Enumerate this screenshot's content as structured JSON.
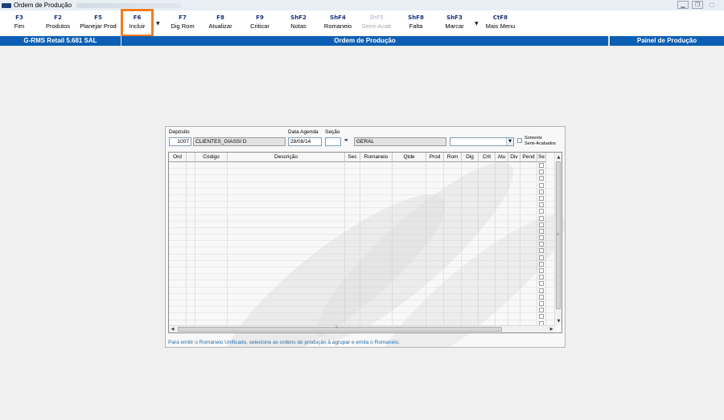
{
  "window": {
    "title": "Ordem de Produção",
    "controls": [
      "minimize-icon",
      "restore-icon",
      "close-icon"
    ]
  },
  "toolbar": {
    "buttons": [
      {
        "key": "F3",
        "label": "Fim",
        "enabled": true
      },
      {
        "key": "F2",
        "label": "Produtos",
        "enabled": true
      },
      {
        "key": "F5",
        "label": "Planejar Prod",
        "enabled": true
      },
      {
        "key": "F6",
        "label": "Incluir",
        "enabled": true,
        "highlighted": true
      },
      {
        "key": "F7",
        "label": "Dig Rom",
        "enabled": true
      },
      {
        "key": "F8",
        "label": "Atualizar",
        "enabled": true
      },
      {
        "key": "F9",
        "label": "Criticar",
        "enabled": true
      },
      {
        "key": "ShF2",
        "label": "Notas",
        "enabled": true
      },
      {
        "key": "ShF4",
        "label": "Romaneio",
        "enabled": true
      },
      {
        "key": "ShF5",
        "label": "Semi-Acab",
        "enabled": false
      },
      {
        "key": "ShF8",
        "label": "Falta",
        "enabled": true
      },
      {
        "key": "ShF3",
        "label": "Marcar",
        "enabled": true
      },
      {
        "key": "CtF8",
        "label": "Mais Menu",
        "enabled": true
      }
    ]
  },
  "header": {
    "left": "G-RMS Retail 5.681 SAL",
    "center": "Ordem de Produção",
    "right": "Painel de Produção"
  },
  "filters": {
    "deposito_label": "Depósito",
    "deposito_code": "1007",
    "deposito_name": "CLIENTES_GIASSI D",
    "data_agenda_label": "Data Agenda",
    "data_agenda_value": "28/08/14",
    "secao_label": "Seção",
    "secao_value": "",
    "secao_name": "GERAL",
    "combo_value": "",
    "somente_label_1": "Somente",
    "somente_label_2": "Semi-Acabados",
    "somente_checked": false
  },
  "grid": {
    "columns": [
      "Ord",
      "",
      "Código",
      "Descrição",
      "Sec",
      "Romaneio",
      "Qtde",
      "Prod",
      "Rom",
      "Dig",
      "Crit",
      "Atu",
      "Div",
      "Pend",
      "Se"
    ],
    "visible_rows": 25
  },
  "hint": "Para emitir o Romaneio Unificado, selecione as ordens de produção à agrupar e emita o Romaneio.",
  "colors": {
    "header_blue": "#0c5fb4",
    "key_text": "#1b2f78",
    "highlight": "#f07d21",
    "hint_text": "#2770aa"
  }
}
